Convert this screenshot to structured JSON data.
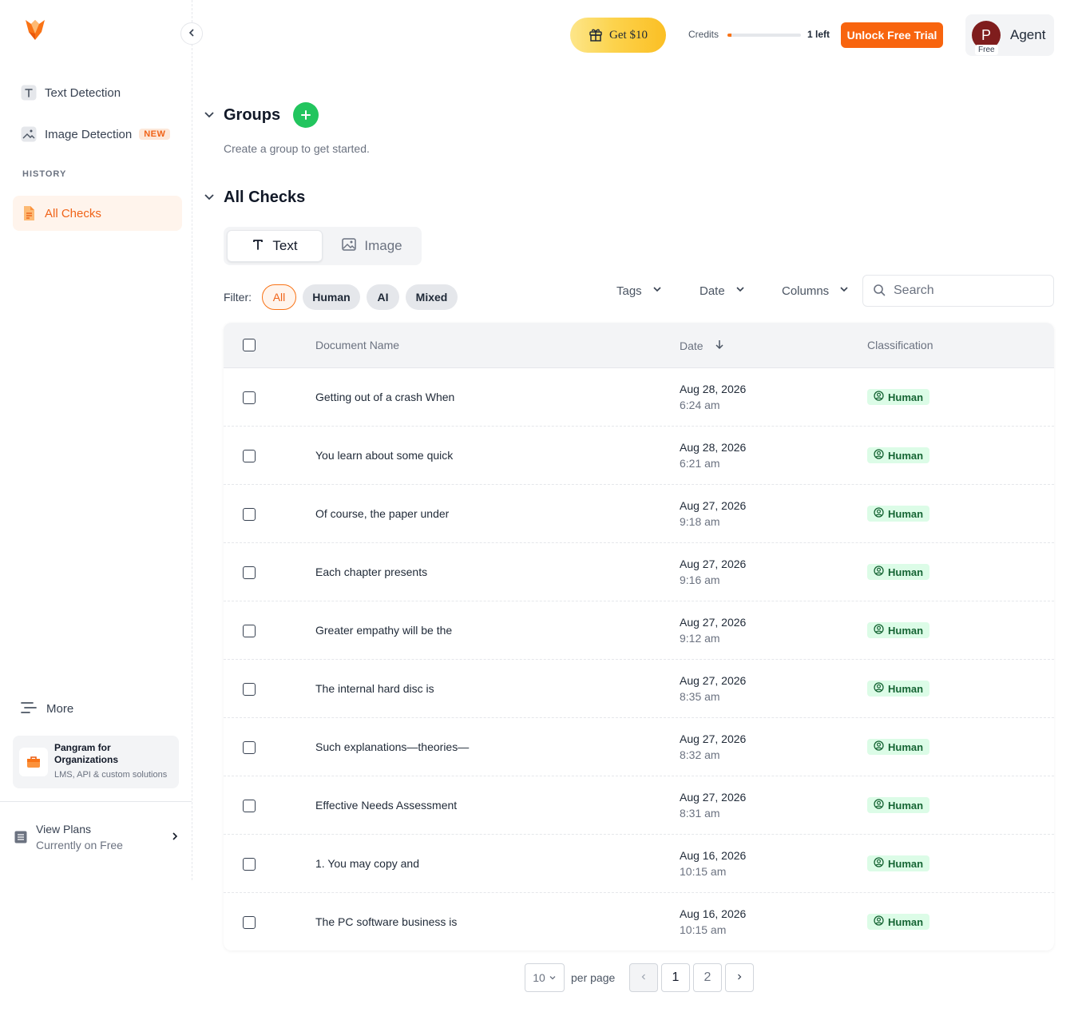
{
  "colors": {
    "accent": "#f8640e",
    "success": "#22c55e",
    "human_badge_bg": "#dcfce7",
    "human_badge_text": "#166534"
  },
  "sidebar": {
    "nav": [
      {
        "label": "Text Detection",
        "icon": "text-t-icon"
      },
      {
        "label": "Image Detection",
        "icon": "image-icon",
        "badge": "NEW"
      }
    ],
    "history_label": "HISTORY",
    "history_item": {
      "label": "All Checks",
      "icon": "document-icon"
    },
    "more_label": "More",
    "org": {
      "title": "Pangram for Organizations",
      "subtitle": "LMS, API & custom solutions"
    },
    "plans": {
      "title": "View Plans",
      "subtitle": "Currently on Free"
    }
  },
  "header": {
    "promo_label": "Get $10",
    "credits_label": "Credits",
    "credits_used_fraction": 0.05,
    "credits_left": "1 left",
    "unlock_label": "Unlock Free Trial",
    "user": {
      "initial": "P",
      "plan": "Free",
      "name": "Agent"
    }
  },
  "groups": {
    "title": "Groups",
    "empty_text": "Create a group to get started."
  },
  "checks": {
    "title": "All Checks",
    "tabs": [
      {
        "label": "Text",
        "active": true
      },
      {
        "label": "Image",
        "active": false
      }
    ],
    "filter_label": "Filter:",
    "filters": [
      "All",
      "Human",
      "AI",
      "Mixed"
    ],
    "active_filter": "All",
    "dropdowns": [
      "Tags",
      "Date",
      "Columns"
    ],
    "search_placeholder": "Search",
    "columns": {
      "name": "Document Name",
      "date": "Date",
      "classification": "Classification"
    },
    "rows": [
      {
        "name": "Getting out of a crash When",
        "date": "Aug 28, 2026",
        "time": "6:24 am",
        "classification": "Human"
      },
      {
        "name": "You learn about some quick",
        "date": "Aug 28, 2026",
        "time": "6:21 am",
        "classification": "Human"
      },
      {
        "name": "Of course, the paper under",
        "date": "Aug 27, 2026",
        "time": "9:18 am",
        "classification": "Human"
      },
      {
        "name": "Each chapter presents",
        "date": "Aug 27, 2026",
        "time": "9:16 am",
        "classification": "Human"
      },
      {
        "name": "Greater empathy will be the",
        "date": "Aug 27, 2026",
        "time": "9:12 am",
        "classification": "Human"
      },
      {
        "name": "The internal hard disc is",
        "date": "Aug 27, 2026",
        "time": "8:35 am",
        "classification": "Human"
      },
      {
        "name": "Such explanations—theories—",
        "date": "Aug 27, 2026",
        "time": "8:32 am",
        "classification": "Human"
      },
      {
        "name": "Effective Needs Assessment",
        "date": "Aug 27, 2026",
        "time": "8:31 am",
        "classification": "Human"
      },
      {
        "name": "1. You may copy and",
        "date": "Aug 16, 2026",
        "time": "10:15 am",
        "classification": "Human"
      },
      {
        "name": "The PC software business is",
        "date": "Aug 16, 2026",
        "time": "10:15 am",
        "classification": "Human"
      }
    ]
  },
  "pagination": {
    "per_page": "10",
    "per_page_label": "per page",
    "pages": [
      "1",
      "2"
    ],
    "current": "1"
  }
}
